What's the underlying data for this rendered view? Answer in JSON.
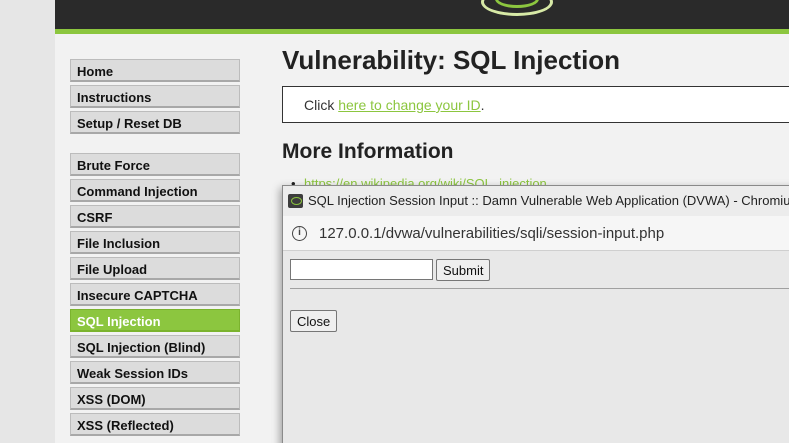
{
  "brand": {
    "accent": "#8cc63f",
    "header_bg": "#2a2a2a"
  },
  "sidebar": {
    "group1": [
      {
        "label": "Home"
      },
      {
        "label": "Instructions"
      },
      {
        "label": "Setup / Reset DB"
      }
    ],
    "group2": [
      {
        "label": "Brute Force"
      },
      {
        "label": "Command Injection"
      },
      {
        "label": "CSRF"
      },
      {
        "label": "File Inclusion"
      },
      {
        "label": "File Upload"
      },
      {
        "label": "Insecure CAPTCHA"
      },
      {
        "label": "SQL Injection",
        "active": true
      },
      {
        "label": "SQL Injection (Blind)"
      },
      {
        "label": "Weak Session IDs"
      },
      {
        "label": "XSS (DOM)"
      },
      {
        "label": "XSS (Reflected)"
      }
    ]
  },
  "main": {
    "title": "Vulnerability: SQL Injection",
    "click_prefix": "Click ",
    "click_link": "here to change your ID",
    "click_suffix": ".",
    "more_info_title": "More Information",
    "more_info_link": "https://en.wikipedia.org/wiki/SQL_injection"
  },
  "popup": {
    "window_title": "SQL Injection Session Input :: Damn Vulnerable Web Application (DVWA) - Chromium",
    "url": "127.0.0.1/dvwa/vulnerabilities/sqli/session-input.php",
    "input_value": "",
    "submit_label": "Submit",
    "close_label": "Close"
  }
}
